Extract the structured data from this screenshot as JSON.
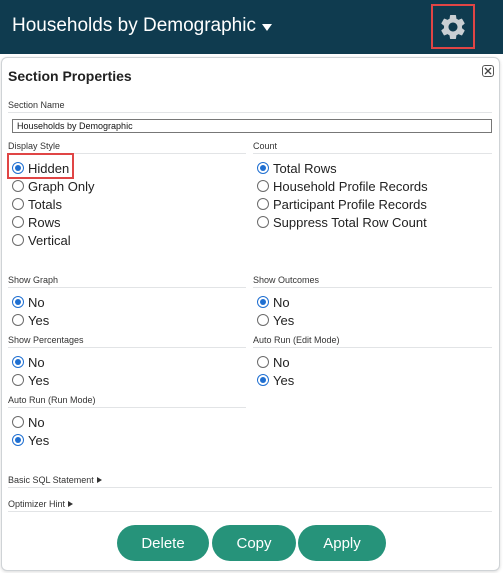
{
  "header": {
    "title": "Households by Demographic",
    "background": "#0f3b4f",
    "highlight_color": "#e04545",
    "gear_icon": "gear-icon",
    "caret_icon": "caret-down-icon"
  },
  "panel": {
    "title": "Section Properties",
    "close_icon": "close-icon",
    "section_name_label": "Section Name",
    "section_name_value": "Households by Demographic",
    "display_style": {
      "label": "Display Style",
      "options": [
        "Hidden",
        "Graph Only",
        "Totals",
        "Rows",
        "Vertical"
      ],
      "selected": "Hidden"
    },
    "count": {
      "label": "Count",
      "options": [
        "Total Rows",
        "Household Profile Records",
        "Participant Profile Records",
        "Suppress Total Row Count"
      ],
      "selected": "Total Rows"
    },
    "show_graph": {
      "label": "Show Graph",
      "options": [
        "No",
        "Yes"
      ],
      "selected": "No"
    },
    "show_outcomes": {
      "label": "Show Outcomes",
      "options": [
        "No",
        "Yes"
      ],
      "selected": "No"
    },
    "show_percentages": {
      "label": "Show Percentages",
      "options": [
        "No",
        "Yes"
      ],
      "selected": "No"
    },
    "auto_run_edit": {
      "label": "Auto Run (Edit Mode)",
      "options": [
        "No",
        "Yes"
      ],
      "selected": "Yes"
    },
    "auto_run_run": {
      "label": "Auto Run (Run Mode)",
      "options": [
        "No",
        "Yes"
      ],
      "selected": "Yes"
    },
    "basic_sql_label": "Basic SQL Statement",
    "optimizer_hint_label": "Optimizer Hint",
    "buttons": {
      "delete": "Delete",
      "copy": "Copy",
      "apply": "Apply"
    },
    "accent_color": "#26937a",
    "radio_color": "#1f6fd1"
  }
}
